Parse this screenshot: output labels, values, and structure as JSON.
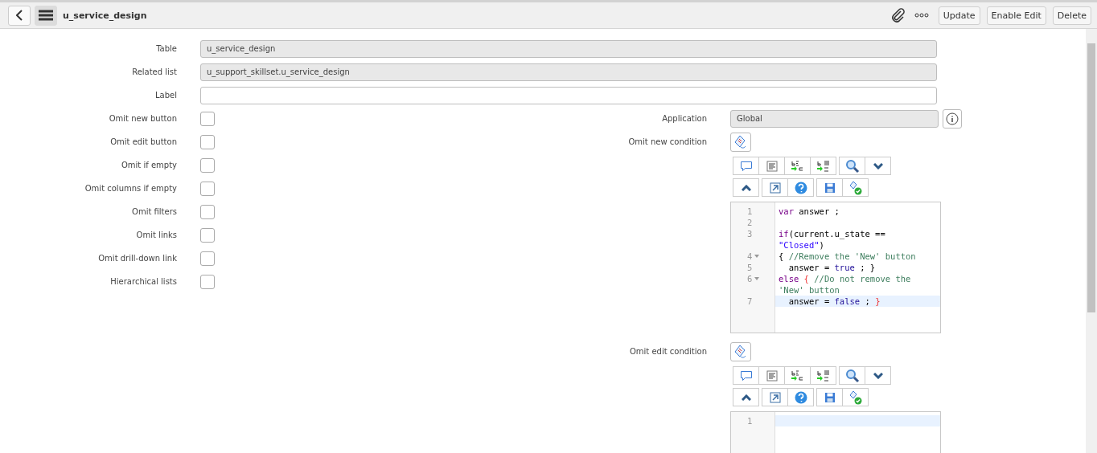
{
  "header": {
    "title": "u_service_design",
    "buttons": [
      "Update",
      "Enable Edit",
      "Delete"
    ]
  },
  "top_fields": [
    {
      "label": "Table",
      "value": "u_service_design",
      "readonly": true
    },
    {
      "label": "Related list",
      "value": "u_support_skillset.u_service_design",
      "readonly": true
    },
    {
      "label": "Label",
      "readonly": false
    }
  ],
  "checkboxes": [
    {
      "label": "Omit new button",
      "checked": false
    },
    {
      "label": "Omit edit button",
      "checked": false
    },
    {
      "label": "Omit if empty",
      "checked": false
    },
    {
      "label": "Omit columns if empty",
      "checked": false
    },
    {
      "label": "Omit filters",
      "checked": false
    },
    {
      "label": "Omit links",
      "checked": false
    },
    {
      "label": "Omit drill-down link",
      "checked": false
    },
    {
      "label": "Hierarchical lists",
      "checked": false
    }
  ],
  "application": {
    "label": "Application",
    "value": "Global"
  },
  "conditions": [
    {
      "label": "Omit new condition",
      "rows": [
        {
          "number": "1",
          "fold": false,
          "active": false,
          "tokens": [
            {
              "kind": "keyword",
              "text": "var"
            },
            {
              "kind": "plain",
              "text": " answer ;"
            }
          ]
        },
        {
          "number": "2",
          "fold": false,
          "active": false
        },
        {
          "number": "3",
          "fold": false,
          "active": false,
          "tokens": [
            {
              "kind": "keyword",
              "text": "if"
            },
            {
              "kind": "plain",
              "text": "(current.u_state =="
            }
          ]
        },
        {
          "fold": false,
          "active": false,
          "tokens": [
            {
              "kind": "string",
              "text": "\"Closed\""
            },
            {
              "kind": "plain",
              "text": ")"
            }
          ]
        },
        {
          "number": "4",
          "fold": true,
          "active": false,
          "tokens": [
            {
              "kind": "plain",
              "text": "{ "
            },
            {
              "kind": "comment",
              "text": "//Remove the 'New' button"
            }
          ]
        },
        {
          "number": "5",
          "fold": false,
          "active": false,
          "tokens": [
            {
              "kind": "plain",
              "text": "  answer = "
            },
            {
              "kind": "atom",
              "text": "true"
            },
            {
              "kind": "plain",
              "text": " ; }"
            }
          ]
        },
        {
          "number": "6",
          "fold": true,
          "active": false,
          "tokens": [
            {
              "kind": "keyword",
              "text": "else"
            },
            {
              "kind": "bracket",
              "text": " {"
            },
            {
              "kind": "comment",
              "text": " //Do not remove the"
            }
          ]
        },
        {
          "fold": false,
          "active": false,
          "tokens": [
            {
              "kind": "comment",
              "text": "'New' button"
            }
          ]
        },
        {
          "number": "7",
          "fold": false,
          "active": true,
          "tokens": [
            {
              "kind": "plain",
              "text": "  answer = "
            },
            {
              "kind": "atom",
              "text": "false"
            },
            {
              "kind": "plain",
              "text": " ; "
            },
            {
              "kind": "bracket",
              "text": "}"
            }
          ]
        }
      ]
    },
    {
      "label": "Omit edit condition",
      "rows": [
        {
          "number": "1",
          "fold": false,
          "active": true
        }
      ]
    }
  ]
}
